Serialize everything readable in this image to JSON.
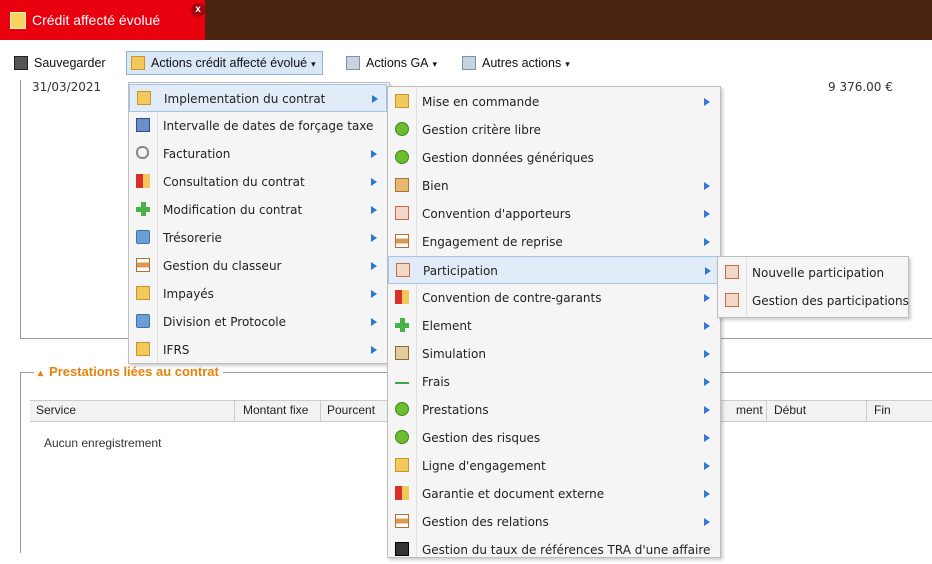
{
  "tab": {
    "title": "Crédit affecté évolué",
    "close": "x"
  },
  "toolbar": {
    "save": "Sauvegarder",
    "actions_credit": "Actions crédit affecté évolué",
    "actions_ga": "Actions GA",
    "autres": "Autres actions",
    "caret": "▾"
  },
  "background": {
    "date_fragment": "31/03/2021",
    "amount_fragment": "9 376.00 €",
    "legend": "Prestations liées au contrat",
    "legend_toggle": "▴",
    "columns": [
      "Service",
      "Montant fixe",
      "Pourcent",
      "ment",
      "Début",
      "Fin"
    ],
    "empty": "Aucun enregistrement"
  },
  "menu1": [
    {
      "label": "Implementation du contrat",
      "icon": "people-icon",
      "arrow": true
    },
    {
      "label": "Intervalle de dates de forçage taxe",
      "icon": "calendar-icon",
      "arrow": false
    },
    {
      "label": "Facturation",
      "icon": "magnifier-icon",
      "arrow": true
    },
    {
      "label": "Consultation du contrat",
      "icon": "report-icon",
      "arrow": true
    },
    {
      "label": "Modification du contrat",
      "icon": "plus-icon",
      "arrow": true
    },
    {
      "label": "Trésorerie",
      "icon": "treasury-icon",
      "arrow": true
    },
    {
      "label": "Gestion du classeur",
      "icon": "binder-icon",
      "arrow": true
    },
    {
      "label": "Impayés",
      "icon": "unpaid-icon",
      "arrow": true
    },
    {
      "label": "Division et Protocole",
      "icon": "division-icon",
      "arrow": true
    },
    {
      "label": "IFRS",
      "icon": "ifrs-icon",
      "arrow": true
    }
  ],
  "menu2": [
    {
      "label": "Mise en commande",
      "icon": "people-icon",
      "arrow": true
    },
    {
      "label": "Gestion critère libre",
      "icon": "add-circle-icon",
      "arrow": false
    },
    {
      "label": "Gestion données génériques",
      "icon": "add-circle-icon",
      "arrow": false
    },
    {
      "label": "Bien",
      "icon": "asset-icon",
      "arrow": true
    },
    {
      "label": "Convention d'apporteurs",
      "icon": "convention-icon",
      "arrow": true
    },
    {
      "label": "Engagement de reprise",
      "icon": "binder-icon",
      "arrow": true
    },
    {
      "label": "Participation",
      "icon": "convention-icon",
      "arrow": true
    },
    {
      "label": "Convention de contre-garants",
      "icon": "report-icon",
      "arrow": true
    },
    {
      "label": "Element",
      "icon": "plus-icon",
      "arrow": true
    },
    {
      "label": "Simulation",
      "icon": "simulation-icon",
      "arrow": true
    },
    {
      "label": "Frais",
      "icon": "fees-icon",
      "arrow": true
    },
    {
      "label": "Prestations",
      "icon": "add-circle-icon",
      "arrow": true
    },
    {
      "label": "Gestion des risques",
      "icon": "risk-icon",
      "arrow": true
    },
    {
      "label": "Ligne d'engagement",
      "icon": "people-icon",
      "arrow": true
    },
    {
      "label": "Garantie et document externe",
      "icon": "report-icon",
      "arrow": true
    },
    {
      "label": "Gestion des relations",
      "icon": "binder-icon",
      "arrow": true
    },
    {
      "label": "Gestion du taux de références TRA d'une affaire",
      "icon": "rate-icon",
      "arrow": false
    }
  ],
  "menu3": [
    {
      "label": "Nouvelle participation",
      "icon": "participation-icon"
    },
    {
      "label": "Gestion des participations",
      "icon": "participation-icon"
    }
  ],
  "colors": {
    "topbar": "#4a2410",
    "tab": "#e8000f",
    "legend": "#e6820a",
    "arrow": "#2f78d0"
  }
}
